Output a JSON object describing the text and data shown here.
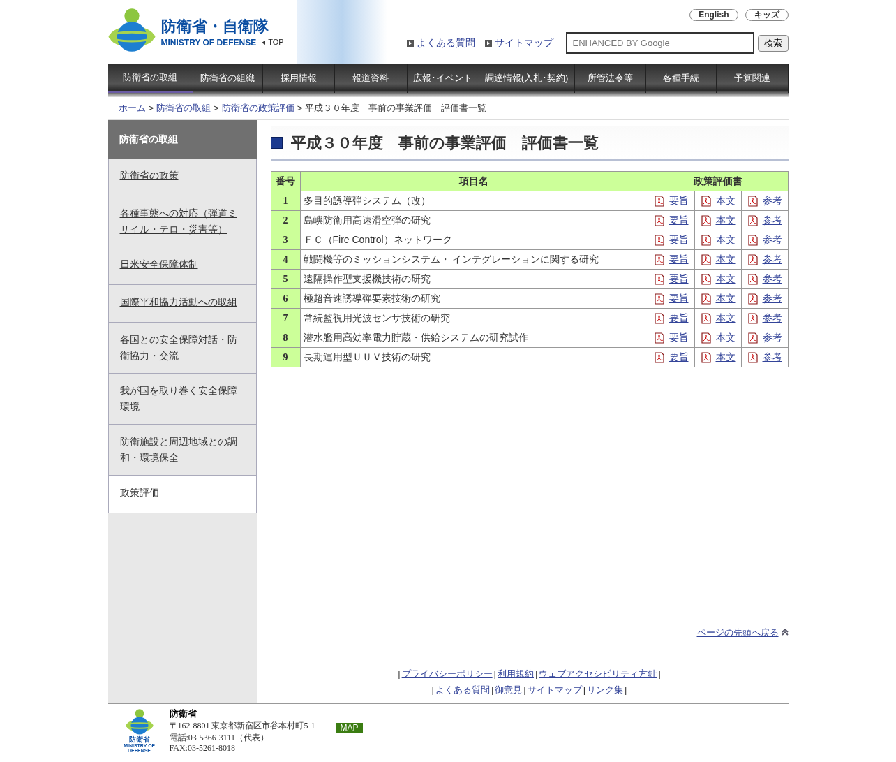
{
  "header": {
    "logo_title": "防衛省・自衛隊",
    "logo_subtitle": "MINISTRY OF DEFENSE",
    "top_link": "TOP",
    "lang_buttons": [
      "English",
      "キッズ"
    ],
    "links": [
      "よくある質問",
      "サイトマップ"
    ],
    "search": {
      "placeholder": "ENHANCED BY Google",
      "button": "検索"
    }
  },
  "nav": [
    {
      "label": "防衛省の取組",
      "selected": true
    },
    {
      "label": "防衛省の組織",
      "selected": false
    },
    {
      "label": "採用情報",
      "selected": false
    },
    {
      "label": "報道資料",
      "selected": false
    },
    {
      "label": "広報･イベント",
      "selected": false
    },
    {
      "label": "調達情報(入札･契約)",
      "selected": false
    },
    {
      "label": "所管法令等",
      "selected": false
    },
    {
      "label": "各種手続",
      "selected": false
    },
    {
      "label": "予算関連",
      "selected": false
    }
  ],
  "breadcrumb": {
    "links": [
      "ホーム",
      "防衛省の取組",
      "防衛省の政策評価"
    ],
    "separator": ">",
    "current": "平成３０年度　事前の事業評価　評価書一覧"
  },
  "sidebar": {
    "title": "防衛省の取組",
    "items": [
      {
        "label": "防衛省の政策",
        "selected": false
      },
      {
        "label": "各種事態への対応（弾道ミサイル・テロ・災害等）",
        "selected": false
      },
      {
        "label": "日米安全保障体制",
        "selected": false
      },
      {
        "label": "国際平和協力活動への取組",
        "selected": false
      },
      {
        "label": "各国との安全保障対話・防衛協力・交流",
        "selected": false
      },
      {
        "label": "我が国を取り巻く安全保障環境",
        "selected": false
      },
      {
        "label": "防衛施設と周辺地域との調和・環境保全",
        "selected": false
      },
      {
        "label": "政策評価",
        "selected": true
      }
    ]
  },
  "page_title": "平成３０年度　事前の事業評価　評価書一覧",
  "table": {
    "columns": [
      "番号",
      "項目名",
      "政策評価書"
    ],
    "rows": [
      {
        "number": "1",
        "name": "多目的誘導弾システム（改）",
        "docs": [
          "要旨",
          "本文",
          "参考"
        ]
      },
      {
        "number": "2",
        "name": "島嶼防衛用高速滑空弾の研究",
        "docs": [
          "要旨",
          "本文",
          "参考"
        ]
      },
      {
        "number": "3",
        "name": "ＦＣ（Fire Control）ネットワーク",
        "docs": [
          "要旨",
          "本文",
          "参考"
        ]
      },
      {
        "number": "4",
        "name": "戦闘機等のミッションシステム・ インテグレーションに関する研究",
        "docs": [
          "要旨",
          "本文",
          "参考"
        ]
      },
      {
        "number": "5",
        "name": "遠隔操作型支援機技術の研究",
        "docs": [
          "要旨",
          "本文",
          "参考"
        ]
      },
      {
        "number": "6",
        "name": "極超音速誘導弾要素技術の研究",
        "docs": [
          "要旨",
          "本文",
          "参考"
        ]
      },
      {
        "number": "7",
        "name": "常続監視用光波センサ技術の研究",
        "docs": [
          "要旨",
          "本文",
          "参考"
        ]
      },
      {
        "number": "8",
        "name": "潜水艦用高効率電力貯蔵・供給システムの研究試作",
        "docs": [
          "要旨",
          "本文",
          "参考"
        ]
      },
      {
        "number": "9",
        "name": "長期運用型ＵＵＶ技術の研究",
        "docs": [
          "要旨",
          "本文",
          "参考"
        ]
      }
    ]
  },
  "page_top_link": "ページの先頭へ戻る",
  "footer_links": {
    "separator": "|",
    "rows": [
      [
        "プライバシーポリシー",
        "利用規約",
        "ウェブアクセシビリティ方針"
      ],
      [
        "よくある質問",
        "御意見",
        "サイトマップ",
        "リンク集"
      ]
    ]
  },
  "footer": {
    "logo_name": "防衛省",
    "logo_subtitle": "MINISTRY OF DEFENSE",
    "org": "防衛省",
    "address": "〒162-8801 東京都新宿区市谷本村町5-1",
    "phone": "電話:03-5366-3111（代表）",
    "fax": "FAX:03-5261-8018",
    "map_button": "MAP"
  }
}
